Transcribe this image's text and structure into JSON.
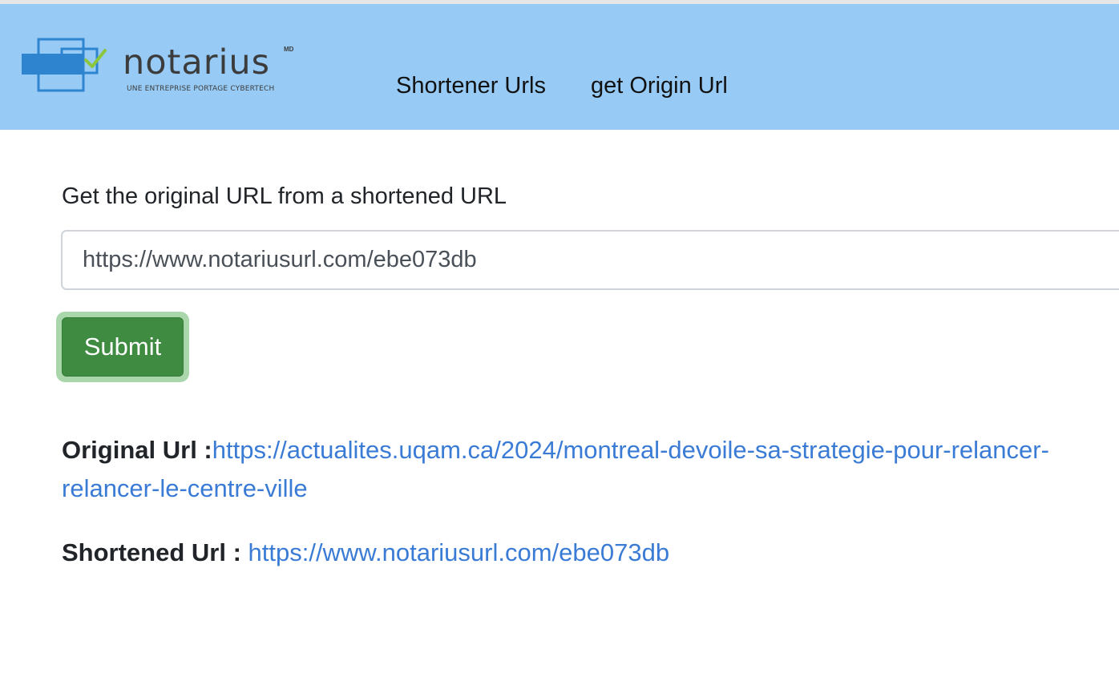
{
  "header": {
    "logo": {
      "brand": "notarius",
      "trademark": "MD",
      "tagline": "UNE ENTREPRISE PORTAGE CYBERTECH"
    },
    "nav": [
      {
        "label": "Shortener Urls"
      },
      {
        "label": "get Origin Url"
      }
    ],
    "background": "#97cbf6"
  },
  "form": {
    "label": "Get the original URL from a shortened URL",
    "input_value": "https://www.notariusurl.com/ebe073db",
    "submit_label": "Submit",
    "submit_color": "#3f8b42"
  },
  "result": {
    "original_label": "Original Url :",
    "original_url_line1": "https://actualites.uqam.ca/2024/montreal-devoile-sa-strategie-pour-relancer-",
    "original_url_line2": "relancer-le-centre-ville",
    "shortened_label": "Shortened Url : ",
    "shortened_url": "https://www.notariusurl.com/ebe073db",
    "link_color": "#3a7bd5"
  }
}
